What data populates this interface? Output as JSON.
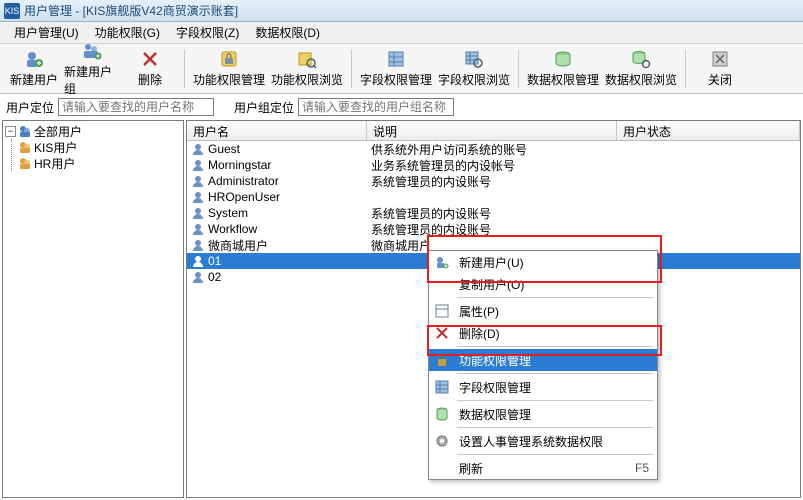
{
  "window": {
    "logo": "KIS",
    "title": "用户管理 - [KIS旗舰版V42商贸演示账套]"
  },
  "menubar": [
    {
      "label": "用户管理(U)"
    },
    {
      "label": "功能权限(G)"
    },
    {
      "label": "字段权限(Z)"
    },
    {
      "label": "数据权限(D)"
    }
  ],
  "toolbar": [
    {
      "key": "new-user",
      "label": "新建用户"
    },
    {
      "key": "new-group",
      "label": "新建用户组"
    },
    {
      "key": "delete",
      "label": "删除"
    },
    {
      "sep": true
    },
    {
      "key": "func-perm",
      "label": "功能权限管理",
      "wide": true
    },
    {
      "key": "func-perm-browse",
      "label": "功能权限浏览",
      "wide": true
    },
    {
      "sep": true
    },
    {
      "key": "field-perm",
      "label": "字段权限管理",
      "wide": true
    },
    {
      "key": "field-perm-browse",
      "label": "字段权限浏览",
      "wide": true
    },
    {
      "sep": true
    },
    {
      "key": "data-perm",
      "label": "数据权限管理",
      "wide": true
    },
    {
      "key": "data-perm-browse",
      "label": "数据权限浏览",
      "wide": true
    },
    {
      "sep": true
    },
    {
      "key": "close",
      "label": "关闭"
    }
  ],
  "filter": {
    "user_label": "用户定位",
    "user_placeholder": "请输入要查找的用户名称",
    "group_label": "用户组定位",
    "group_placeholder": "请输入要查找的用户组名称"
  },
  "tree": {
    "root": "全部用户",
    "children": [
      {
        "label": "KIS用户"
      },
      {
        "label": "HR用户"
      }
    ]
  },
  "grid": {
    "headers": {
      "name": "用户名",
      "desc": "说明",
      "status": "用户状态"
    },
    "rows": [
      {
        "name": "Guest",
        "desc": "供系统外用户访问系统的账号"
      },
      {
        "name": "Morningstar",
        "desc": "业务系统管理员的内设帐号"
      },
      {
        "name": "Administrator",
        "desc": "系统管理员的内设账号"
      },
      {
        "name": "HROpenUser",
        "desc": ""
      },
      {
        "name": "System",
        "desc": "系统管理员的内设账号"
      },
      {
        "name": "Workflow",
        "desc": "系统管理员的内设账号"
      },
      {
        "name": "微商城用户",
        "desc": "微商城用户"
      },
      {
        "name": "01",
        "desc": "",
        "selected": true
      },
      {
        "name": "02",
        "desc": ""
      }
    ]
  },
  "cmenu": {
    "items": [
      {
        "key": "new-user",
        "label": "新建用户(U)",
        "icon": true
      },
      {
        "key": "copy-user",
        "label": "复制用户(O)"
      },
      {
        "sep": true
      },
      {
        "key": "props",
        "label": "属性(P)",
        "icon": true
      },
      {
        "key": "delete",
        "label": "删除(D)",
        "icon": true
      },
      {
        "sep": true
      },
      {
        "key": "func-perm",
        "label": "功能权限管理",
        "icon": true,
        "highlight": true
      },
      {
        "sep": true
      },
      {
        "key": "field-perm",
        "label": "字段权限管理",
        "icon": true
      },
      {
        "sep": true
      },
      {
        "key": "data-perm",
        "label": "数据权限管理",
        "icon": true
      },
      {
        "sep": true
      },
      {
        "key": "hr-data-perm",
        "label": "设置人事管理系统数据权限",
        "icon": true
      },
      {
        "sep": true
      },
      {
        "key": "refresh",
        "label": "刷新",
        "shortcut": "F5"
      }
    ]
  }
}
